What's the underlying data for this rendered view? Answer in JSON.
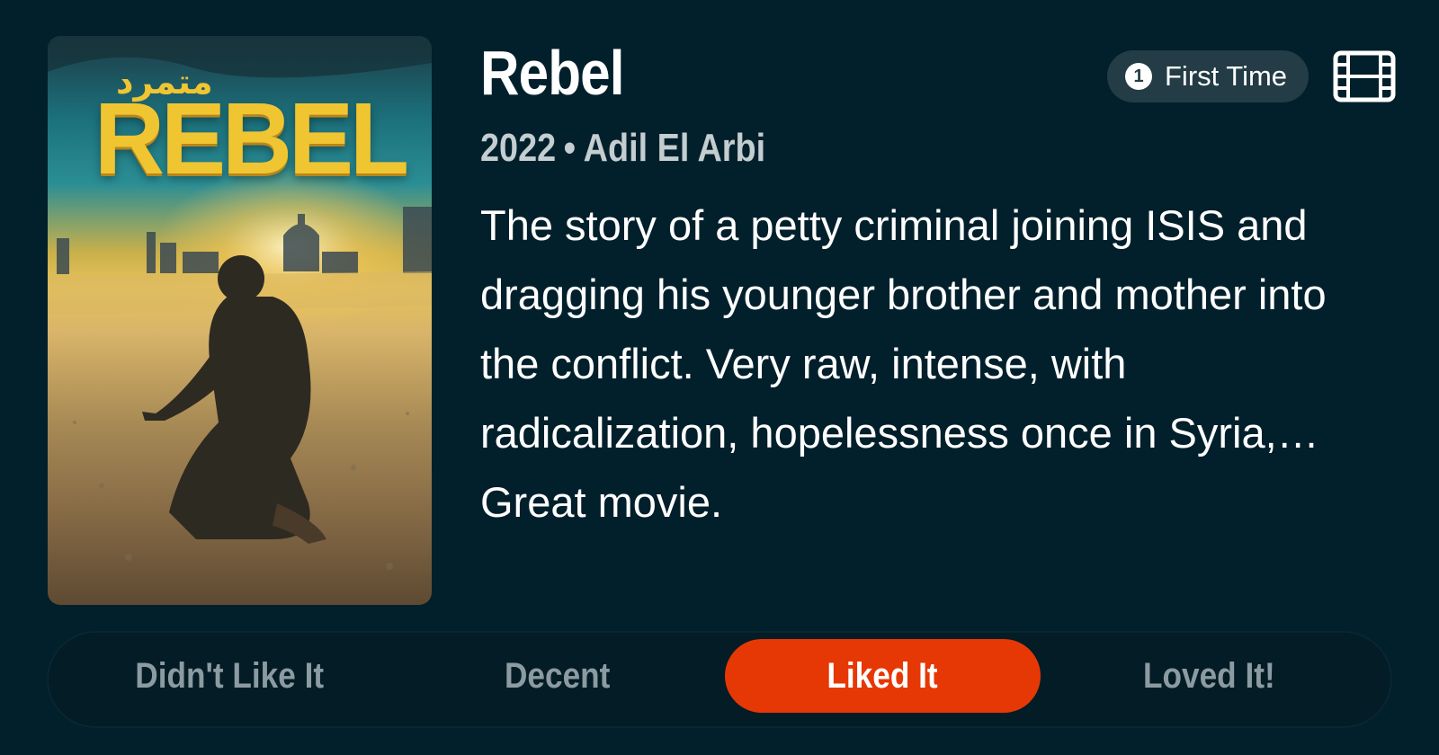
{
  "movie": {
    "title": "Rebel",
    "year": "2022",
    "separator": "•",
    "director": "Adil El Arbi",
    "description": "The story of a petty criminal joining ISIS and dragging his younger brother and mother into the conflict. Very raw, intense, with radicalization, hopelessness once in Syria,… Great movie.",
    "poster": {
      "title_text": "REBEL",
      "arabic_text": "متمرد"
    }
  },
  "badge": {
    "count": "1",
    "label": "First Time"
  },
  "icons": {
    "watch": "film-icon",
    "badge": "number-circle-icon"
  },
  "ratings": [
    {
      "label": "Didn't Like It",
      "selected": false
    },
    {
      "label": "Decent",
      "selected": false
    },
    {
      "label": "Liked It",
      "selected": true
    },
    {
      "label": "Loved It!",
      "selected": false
    }
  ],
  "colors": {
    "background": "#02202b",
    "accent": "#e63805",
    "badge_bg": "#233c45",
    "muted_text": "#8c9ba1"
  }
}
